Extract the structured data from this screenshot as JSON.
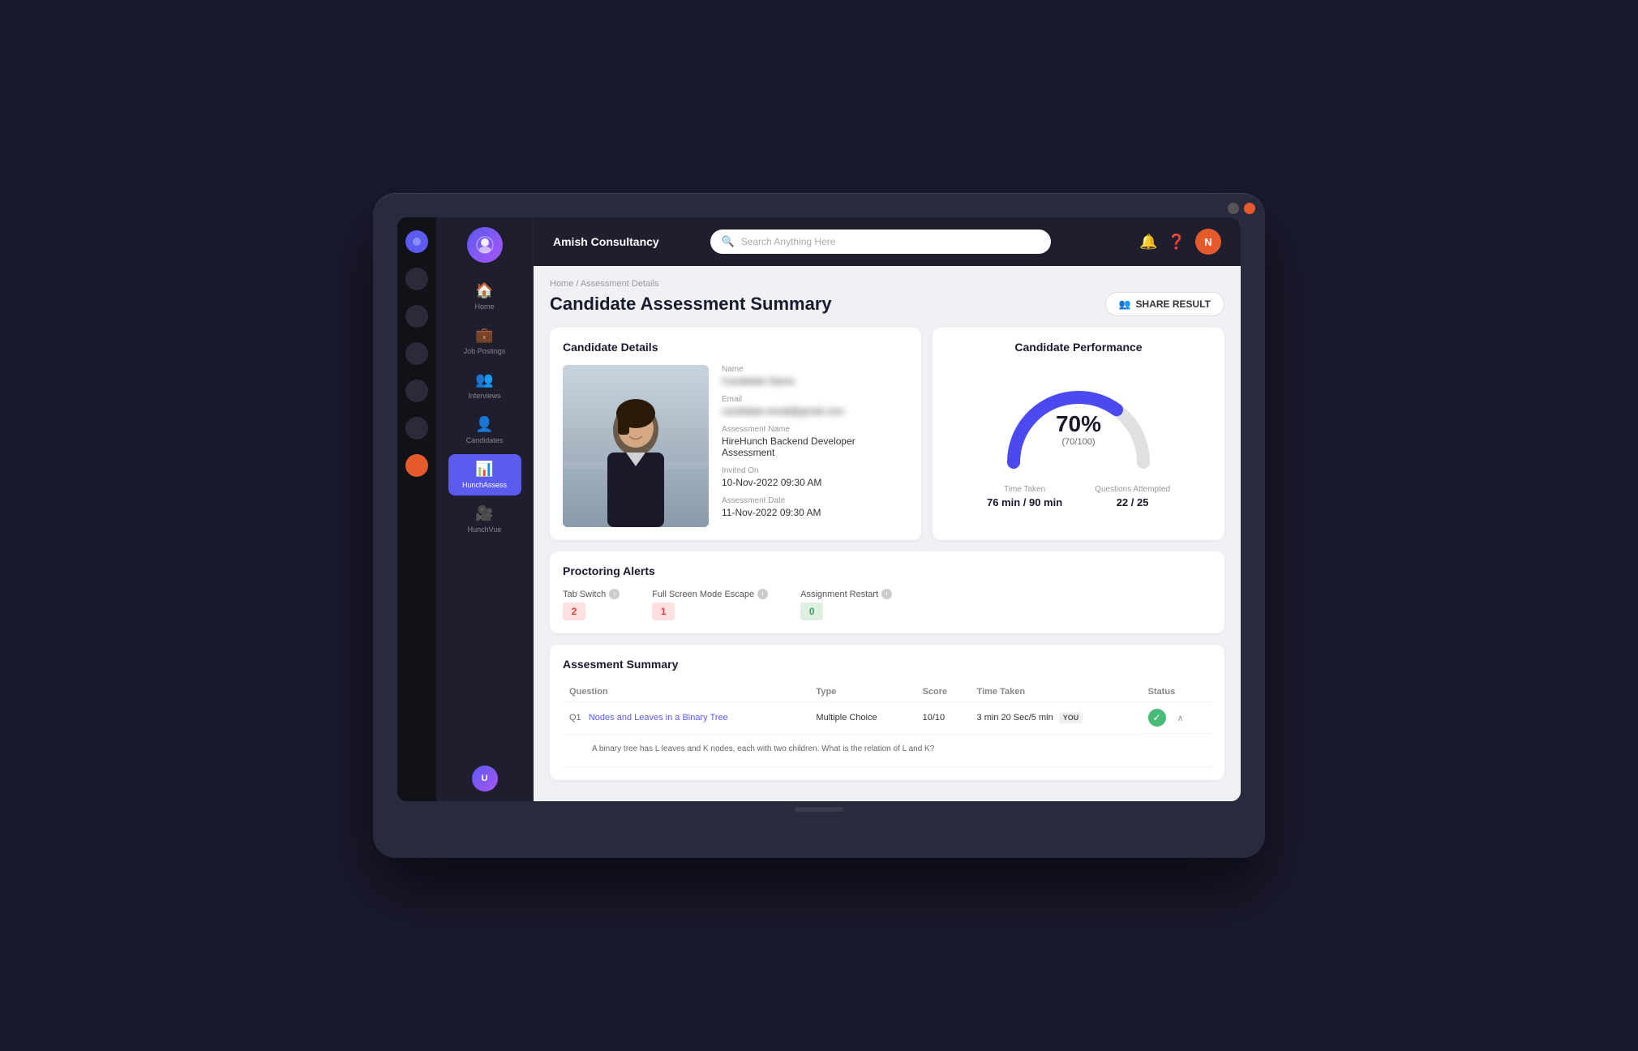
{
  "app": {
    "company_name": "Amish Consultancy",
    "search_placeholder": "Search Anything Here"
  },
  "header": {
    "avatar_letter": "N",
    "share_button_label": "SHARE RESULT"
  },
  "breadcrumb": {
    "home": "Home",
    "separator": "/",
    "current": "Assessment Details"
  },
  "page": {
    "title": "Candidate Assessment Summary"
  },
  "candidate_details": {
    "card_title": "Candidate Details",
    "name_label": "Name",
    "name_value": "Candidate Name",
    "email_label": "Email",
    "email_value": "candidate.email@gmail.com",
    "assessment_name_label": "Assessment Name",
    "assessment_name_value": "HireHunch Backend Developer Assessment",
    "invited_on_label": "Invited On",
    "invited_on_value": "10-Nov-2022 09:30 AM",
    "assessment_date_label": "Assessment Date",
    "assessment_date_value": "11-Nov-2022 09:30 AM"
  },
  "candidate_performance": {
    "card_title": "Candidate Performance",
    "percent": "70%",
    "score": "(70/100)",
    "time_taken_label": "Time Taken",
    "time_taken_value": "76 min / 90 min",
    "questions_attempted_label": "Questions Attempted",
    "questions_attempted_value": "22 / 25",
    "gauge_value": 70
  },
  "proctoring_alerts": {
    "card_title": "Proctoring Alerts",
    "tab_switch_label": "Tab Switch",
    "tab_switch_count": "2",
    "full_screen_label": "Full Screen Mode Escape",
    "full_screen_count": "1",
    "assignment_restart_label": "Assignment Restart",
    "assignment_restart_count": "0"
  },
  "assessment_summary": {
    "card_title": "Assesment Summary",
    "columns": [
      "Question",
      "Type",
      "Score",
      "Time Taken",
      "Status"
    ],
    "rows": [
      {
        "number": "Q1",
        "question": "Nodes and Leaves in a Binary Tree",
        "type": "Multiple Choice",
        "score": "10/10",
        "time_taken": "3 min 20 Sec/5 min",
        "status": "correct",
        "detail": "A binary tree has L leaves and K nodes, each with two children.  What is the relation of L and K?"
      }
    ]
  },
  "sidebar": {
    "items": [
      {
        "label": "Home",
        "icon": "🏠",
        "active": false
      },
      {
        "label": "Job Postings",
        "icon": "💼",
        "active": false
      },
      {
        "label": "Interviews",
        "icon": "👥",
        "active": false
      },
      {
        "label": "Candidates",
        "icon": "👤",
        "active": false
      },
      {
        "label": "HunchAssess",
        "icon": "📊",
        "active": true
      },
      {
        "label": "HunchVue",
        "icon": "🎥",
        "active": false
      }
    ]
  }
}
